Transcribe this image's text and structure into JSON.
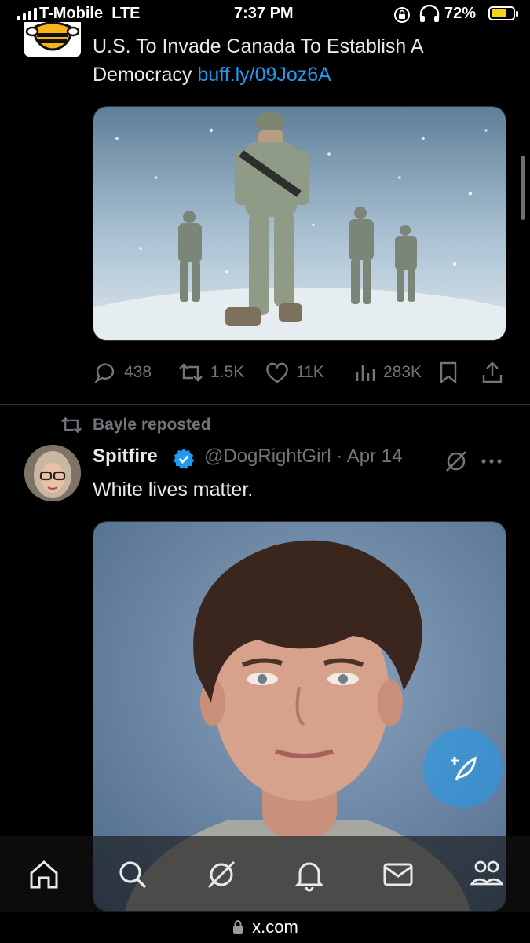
{
  "status_bar": {
    "carrier": "T-Mobile",
    "network": "LTE",
    "time": "7:37 PM",
    "battery_percent": "72%",
    "battery_level": 0.72
  },
  "tweet1": {
    "text_line1": "U.S. To Invade Canada To Establish A",
    "text_line2_plain": "Democracy ",
    "link": "buff.ly/09Joz6A",
    "stats": {
      "replies": "438",
      "reposts": "1.5K",
      "likes": "11K",
      "views": "283K"
    }
  },
  "tweet2": {
    "repost_label": "Bayle reposted",
    "display_name": "Spitfire",
    "handle": "@DogRightGirl",
    "separator": "·",
    "date": "Apr 14",
    "text": "White lives matter."
  },
  "url_bar": {
    "domain": "x.com"
  },
  "colors": {
    "accent": "#1d9bf0",
    "muted": "#71767b",
    "text": "#e7e9ea",
    "battery": "#f7d31a"
  },
  "icons": [
    "signal-icon",
    "headphones-icon",
    "battery-icon",
    "bee-logo",
    "reply-icon",
    "repost-icon",
    "like-icon",
    "views-icon",
    "bookmark-icon",
    "share-icon",
    "verified-badge-icon",
    "grok-icon",
    "more-icon",
    "home-icon",
    "search-icon",
    "grok-nav-icon",
    "notifications-icon",
    "messages-icon",
    "communities-icon",
    "compose-icon",
    "lock-icon"
  ]
}
